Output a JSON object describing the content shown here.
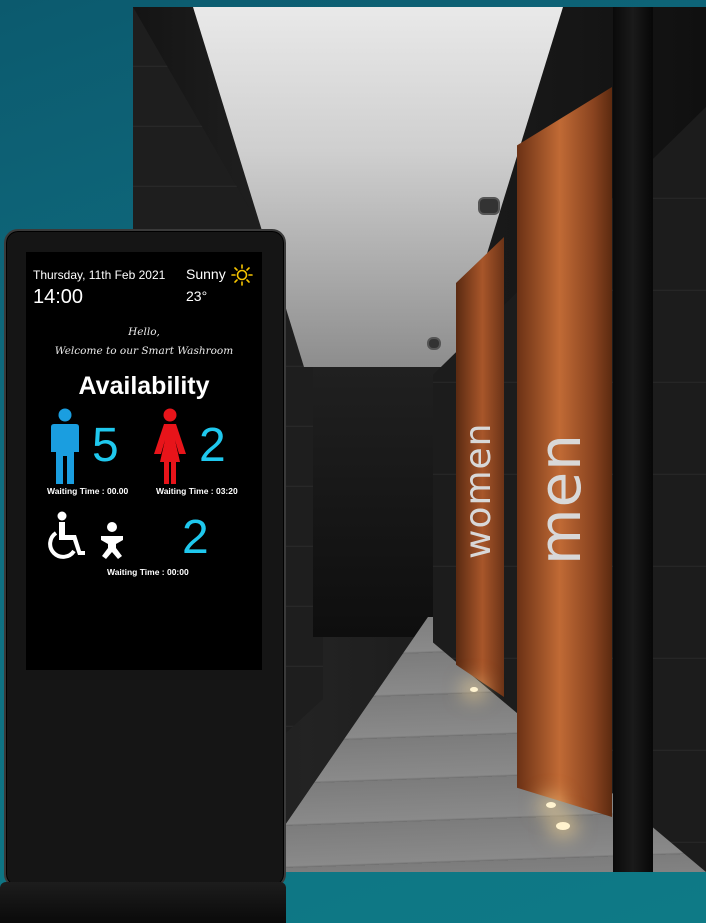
{
  "photo": {
    "sign_women": "women",
    "sign_men": "men"
  },
  "kiosk": {
    "date": "Thursday, 11th Feb 2021",
    "time": "14:00",
    "weather": {
      "condition": "Sunny",
      "temperature": "23°",
      "icon": "sun-icon"
    },
    "greeting_line1": "Hello,",
    "greeting_line2": "Welcome to our Smart Washroom",
    "availability_title": "Availability",
    "men": {
      "icon": "male-icon",
      "count": "5",
      "waiting": "Waiting Time : 00.00",
      "color": "#1a9ee0"
    },
    "women": {
      "icon": "female-icon",
      "count": "2",
      "waiting": "Waiting Time : 03:20",
      "color": "#e8141a"
    },
    "accessible": {
      "icons": [
        "wheelchair-icon",
        "baby-changing-icon"
      ],
      "count": "2",
      "waiting": "Waiting Time : 00:00"
    },
    "accent_color": "#1fc8ee"
  }
}
